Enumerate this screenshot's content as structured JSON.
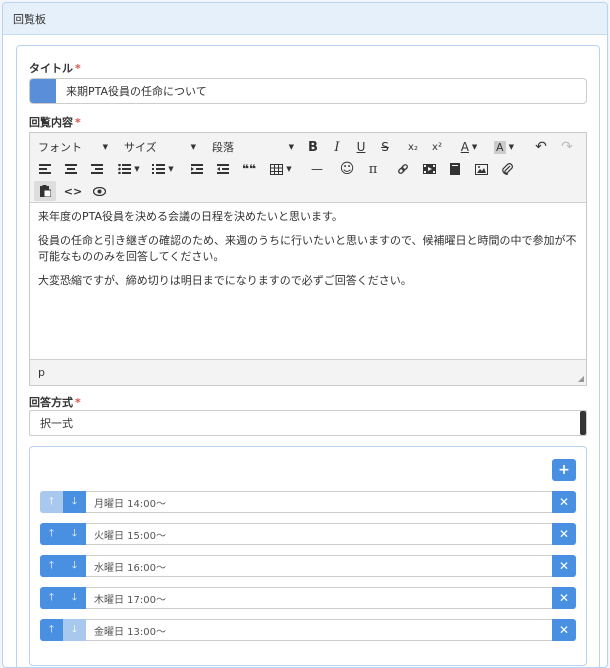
{
  "panel": {
    "title": "回覧板"
  },
  "form": {
    "title_label": "タイトル",
    "required_mark": "*",
    "title_value": "来期PTA役員の任命について",
    "content_label": "回覧内容",
    "answer_label": "回答方式",
    "answer_value": "択一式"
  },
  "toolbar": {
    "font": "フォント",
    "size": "サイズ",
    "paragraph": "段落",
    "bold": "B",
    "italic": "I",
    "underline": "U",
    "strike": "S",
    "subscript": "x₂",
    "superscript": "x²",
    "text_color": "A",
    "bg_color": "A",
    "undo": "↶",
    "redo": "↷",
    "quote": "❝❝",
    "hr": "—",
    "emoji": "☺",
    "math": "π",
    "link": "🔗",
    "code": "<>",
    "preview": "👁"
  },
  "editor": {
    "paragraphs": [
      "来年度のPTA役員を決める会議の日程を決めたいと思います。",
      "役員の任命と引き継ぎの確認のため、来週のうちに行いたいと思いますので、候補曜日と時間の中で参加が不可能なもののみを回答してください。",
      "大変恐縮ですが、締め切りは明日までになりますので必ずご回答ください。"
    ],
    "status": "p"
  },
  "choices": [
    {
      "label": "月曜日 14:00〜"
    },
    {
      "label": "火曜日 15:00〜"
    },
    {
      "label": "水曜日 16:00〜"
    },
    {
      "label": "木曜日 17:00〜"
    },
    {
      "label": "金曜日 13:00〜"
    }
  ],
  "colors": {
    "accent": "#4a90e2",
    "accent_dim": "#a9c8ee",
    "required": "#d9534f"
  }
}
